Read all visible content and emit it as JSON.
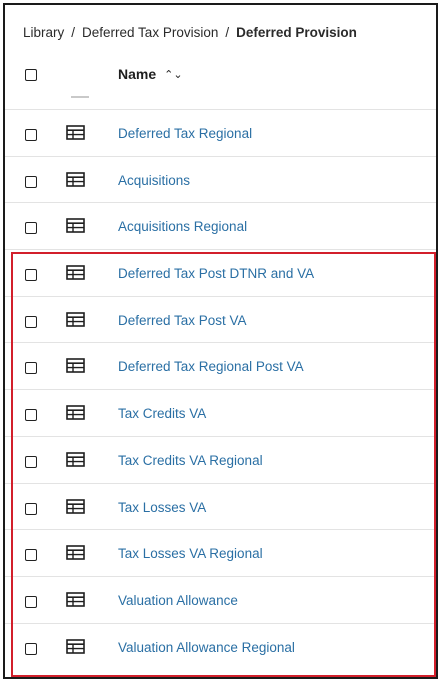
{
  "breadcrumb": {
    "items": [
      "Library",
      "Deferred Tax Provision"
    ],
    "current": "Deferred Provision",
    "separator": "/"
  },
  "table": {
    "name_header": "Name",
    "sort_icon": "sort-updown-icon",
    "rows": [
      "Deferred Tax Regional",
      "Acquisitions",
      "Acquisitions Regional",
      "Deferred Tax Post DTNR and VA",
      "Deferred Tax Post VA",
      "Deferred Tax Regional Post VA",
      "Tax Credits VA",
      "Tax Credits VA Regional",
      "Tax Losses VA",
      "Tax Losses VA Regional",
      "Valuation Allowance",
      "Valuation Allowance Regional"
    ]
  },
  "colors": {
    "link": "#2a6fa4",
    "highlight_border": "#d21f2b"
  }
}
